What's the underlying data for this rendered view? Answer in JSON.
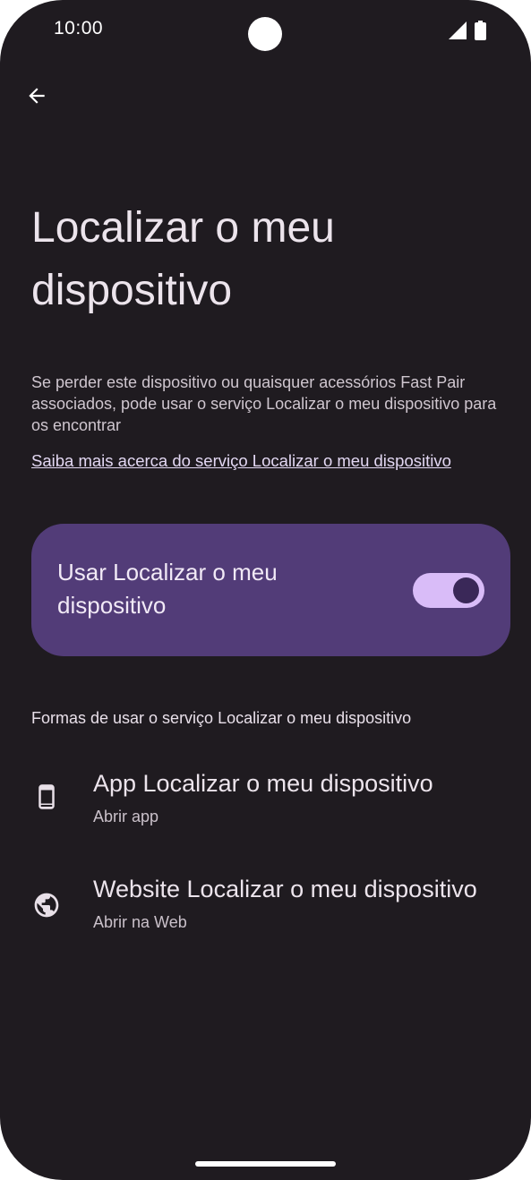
{
  "status_bar": {
    "time": "10:00",
    "signal_icon": "cell-signal-icon",
    "battery_icon": "battery-icon"
  },
  "toolbar": {
    "back_icon": "arrow-back-icon"
  },
  "page": {
    "title": "Localizar o meu dispositivo",
    "description": "Se perder este dispositivo ou quaisquer acessórios Fast Pair associados, pode usar o serviço Localizar o meu dispositivo para os encontrar",
    "learn_more": "Saiba mais acerca do serviço Localizar o meu dispositivo"
  },
  "main_switch": {
    "label": "Usar Localizar o meu dispositivo",
    "checked": true,
    "card_color": "#523c78",
    "track_color": "#d9bcf8",
    "thumb_color": "#3a2858"
  },
  "section": {
    "header": "Formas de usar o serviço Localizar o meu dispositivo"
  },
  "items": [
    {
      "icon": "smartphone-icon",
      "title": "App Localizar o meu dispositivo",
      "subtitle": "Abrir app"
    },
    {
      "icon": "globe-icon",
      "title": "Website Localizar o meu dispositivo",
      "subtitle": "Abrir na Web"
    }
  ],
  "colors": {
    "background": "#1f1b20",
    "accent": "#d9bcf8"
  }
}
